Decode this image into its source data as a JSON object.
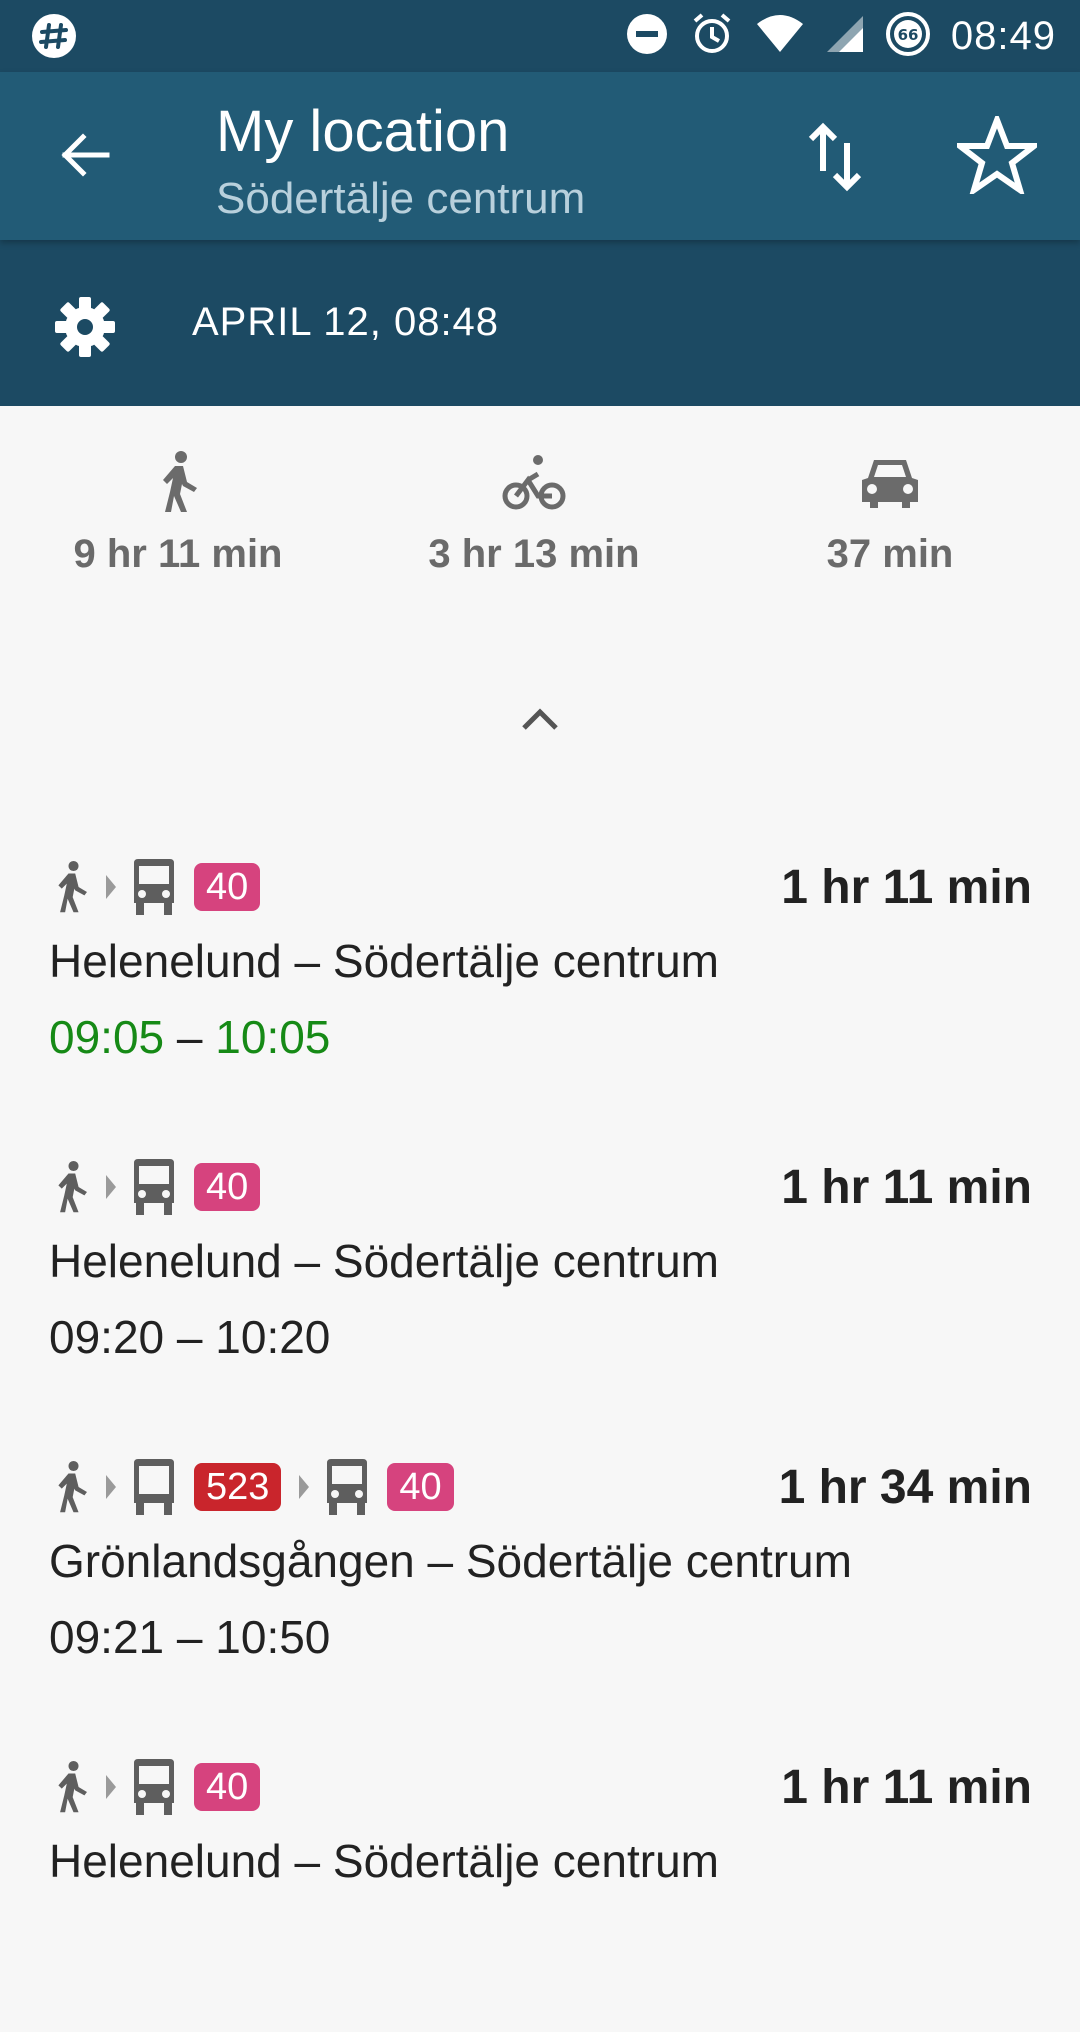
{
  "status_bar": {
    "time": "08:49",
    "icons": [
      "slack-icon",
      "dnd-icon",
      "alarm-icon",
      "wifi-icon",
      "signal-icon",
      "battery-icon"
    ],
    "battery_level": "66"
  },
  "app_bar": {
    "title": "My location",
    "subtitle": "Södertälje centrum"
  },
  "date_bar": {
    "date_text": "APRIL 12, 08:48"
  },
  "modes": [
    {
      "name": "walk",
      "duration": "9 hr 11 min"
    },
    {
      "name": "bike",
      "duration": "3 hr 13 min"
    },
    {
      "name": "car",
      "duration": "37 min"
    }
  ],
  "colors": {
    "status_bar": "#1c4a63",
    "app_bar": "#225b76",
    "bus_badge_pink": "#d6437e",
    "bus_badge_red": "#c9252c",
    "live_time_green": "#168a16"
  },
  "trips": [
    {
      "legs": [
        "walk",
        "bus"
      ],
      "line": "40",
      "duration": "1 hr 11 min",
      "route": "Helenelund – Södertälje centrum",
      "dep": "09:05",
      "arr": "10:05",
      "live": true
    },
    {
      "legs": [
        "walk",
        "bus"
      ],
      "line": "40",
      "duration": "1 hr 11 min",
      "route": "Helenelund – Södertälje centrum",
      "dep": "09:20",
      "arr": "10:20",
      "live": false
    },
    {
      "legs": [
        "walk",
        "bus",
        "bus"
      ],
      "line": "523",
      "line2": "40",
      "duration": "1 hr 34 min",
      "route": "Grönlandsgången – Södertälje centrum",
      "dep": "09:21",
      "arr": "10:50",
      "live": false
    },
    {
      "legs": [
        "walk",
        "bus"
      ],
      "line": "40",
      "duration": "1 hr 11 min",
      "route": "Helenelund – Södertälje centrum",
      "dep": "",
      "arr": "",
      "live": false
    }
  ]
}
